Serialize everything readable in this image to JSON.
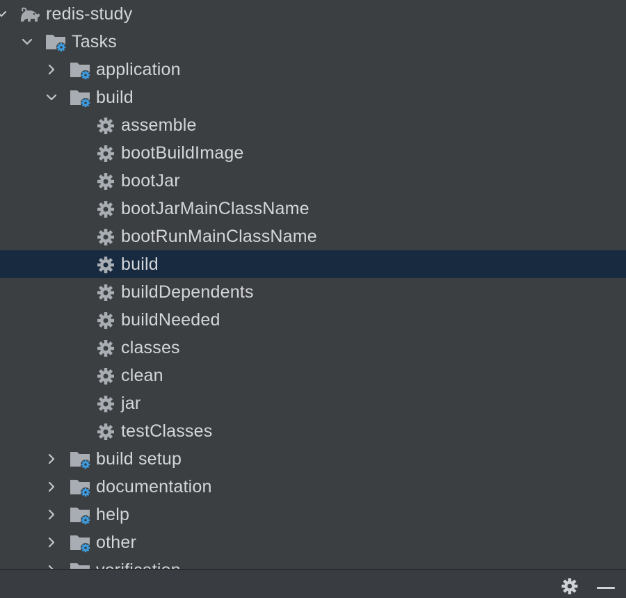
{
  "tree": {
    "root": {
      "label": "redis-study",
      "icon": "gradle-elephant-icon",
      "expanded": true
    },
    "tasks": {
      "label": "Tasks",
      "icon": "task-folder-icon",
      "expanded": true
    },
    "groups_before": [
      {
        "label": "application",
        "expanded": false
      }
    ],
    "build_group": {
      "label": "build",
      "expanded": true,
      "tasks": [
        {
          "label": "assemble"
        },
        {
          "label": "bootBuildImage"
        },
        {
          "label": "bootJar"
        },
        {
          "label": "bootJarMainClassName"
        },
        {
          "label": "bootRunMainClassName"
        },
        {
          "label": "build",
          "selected": true
        },
        {
          "label": "buildDependents"
        },
        {
          "label": "buildNeeded"
        },
        {
          "label": "classes"
        },
        {
          "label": "clean"
        },
        {
          "label": "jar"
        },
        {
          "label": "testClasses"
        }
      ]
    },
    "groups_after": [
      {
        "label": "build setup",
        "expanded": false
      },
      {
        "label": "documentation",
        "expanded": false
      },
      {
        "label": "help",
        "expanded": false
      },
      {
        "label": "other",
        "expanded": false
      },
      {
        "label": "verification",
        "expanded": false
      }
    ]
  },
  "footer": {
    "settings_icon": "gear-icon",
    "minimize_icon": "minimize-icon"
  },
  "colors": {
    "background": "#3c3f41",
    "selection": "#172a40",
    "text": "#d4d6d9",
    "folder": "#a8adb3",
    "gear_badge": "#3d9ee5"
  }
}
